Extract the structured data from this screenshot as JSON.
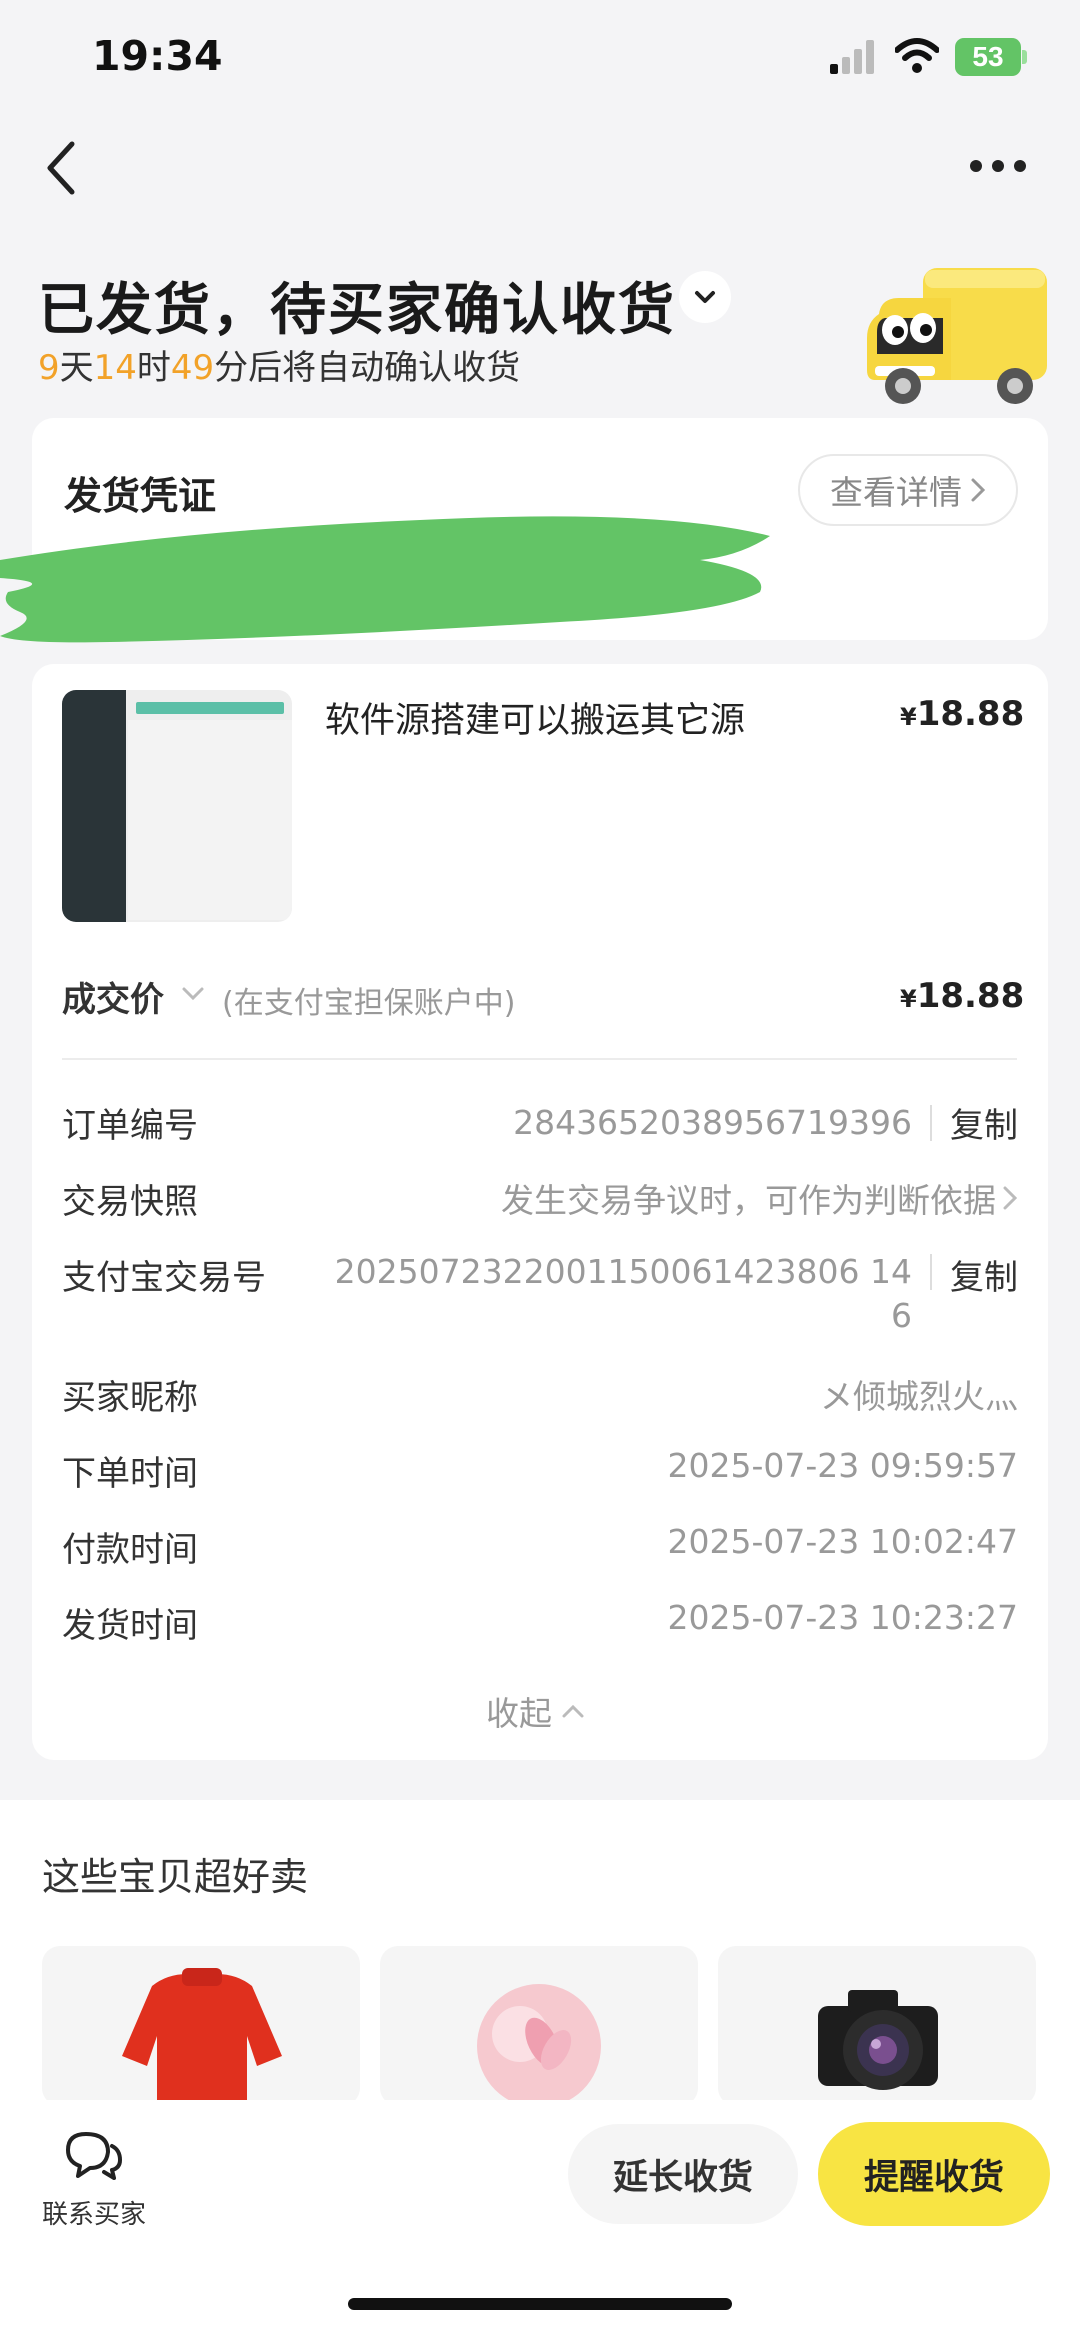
{
  "status_bar": {
    "time": "19:34",
    "battery": "53"
  },
  "header": {
    "title": "已发货，待买家确认收货",
    "countdown": {
      "days": "9",
      "days_unit": "天",
      "hours": "14",
      "hours_unit": "时",
      "minutes": "49",
      "suffix": "分后将自动确认收货"
    }
  },
  "shipping_proof": {
    "title": "发货凭证",
    "detail_button": "查看详情"
  },
  "item": {
    "title": "软件源搭建可以搬运其它源",
    "currency": "¥",
    "price": "18.88"
  },
  "deal": {
    "label": "成交价",
    "note": "(在支付宝担保账户中)",
    "currency": "¥",
    "price": "18.88"
  },
  "order_info": {
    "order_no_label": "订单编号",
    "order_no": "2843652038956719396",
    "copy": "复制",
    "snapshot_label": "交易快照",
    "snapshot_value": "发生交易争议时，可作为判断依据",
    "alipay_label": "支付宝交易号",
    "alipay_line1": "2025072322001150061423806 14",
    "alipay_line2": "6",
    "buyer_label": "买家昵称",
    "buyer_value": "メ倾城烈火灬",
    "order_time_label": "下单时间",
    "order_time": "2025-07-23 09:59:57",
    "pay_time_label": "付款时间",
    "pay_time": "2025-07-23 10:02:47",
    "ship_time_label": "发货时间",
    "ship_time": "2025-07-23 10:23:27",
    "collapse": "收起"
  },
  "recommend": {
    "title": "这些宝贝超好卖"
  },
  "bottom_bar": {
    "contact": "联系买家",
    "extend": "延长收货",
    "remind": "提醒收货"
  }
}
